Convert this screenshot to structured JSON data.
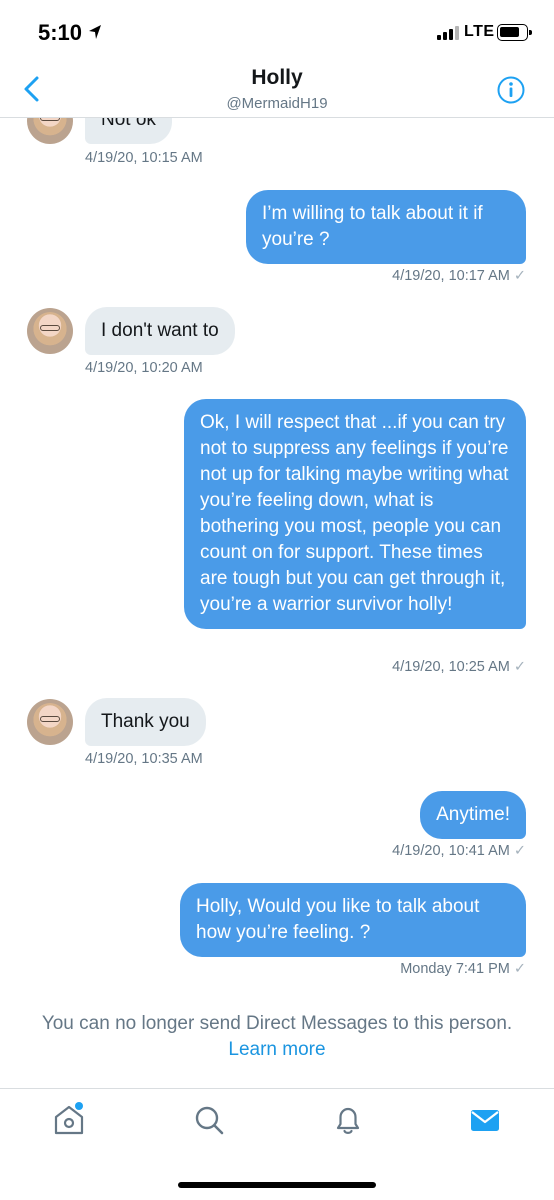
{
  "status": {
    "time": "5:10",
    "network": "LTE"
  },
  "header": {
    "name": "Holly",
    "handle": "@MermaidH19"
  },
  "messages": [
    {
      "dir": "in",
      "text": "Not ok",
      "timestamp": "4/19/20, 10:15 AM"
    },
    {
      "dir": "out",
      "text": "I’m willing to talk about it if you’re ?",
      "timestamp": "4/19/20, 10:17 AM"
    },
    {
      "dir": "in",
      "text": "I don't want to",
      "timestamp": "4/19/20, 10:20 AM"
    },
    {
      "dir": "out",
      "text": "Ok, I will respect that ...if you can try not to suppress any feelings if you’re not up for talking maybe writing what you’re feeling down, what is bothering you most, people you can count on for support. These times are tough but you can get through it, you’re a warrior survivor holly!",
      "timestamp": "4/19/20, 10:25 AM"
    },
    {
      "dir": "in",
      "text": "Thank you",
      "timestamp": "4/19/20, 10:35 AM"
    },
    {
      "dir": "out",
      "text": "Anytime!",
      "timestamp": "4/19/20, 10:41 AM"
    },
    {
      "dir": "out",
      "text": "Holly, Would you like to talk about how you’re feeling. ?",
      "timestamp": "Monday 7:41 PM"
    }
  ],
  "notice": {
    "text": "You can no longer send Direct Messages to this person.",
    "link": "Learn more"
  },
  "tabs": [
    {
      "icon": "home-icon"
    },
    {
      "icon": "search-icon"
    },
    {
      "icon": "notifications-bell-icon"
    },
    {
      "icon": "messages-envelope-icon",
      "active": true
    }
  ],
  "colors": {
    "accent": "#1da1f2",
    "outgoing_bubble": "#4a9be8",
    "incoming_bubble": "#e6ecf0",
    "muted_text": "#657786"
  }
}
